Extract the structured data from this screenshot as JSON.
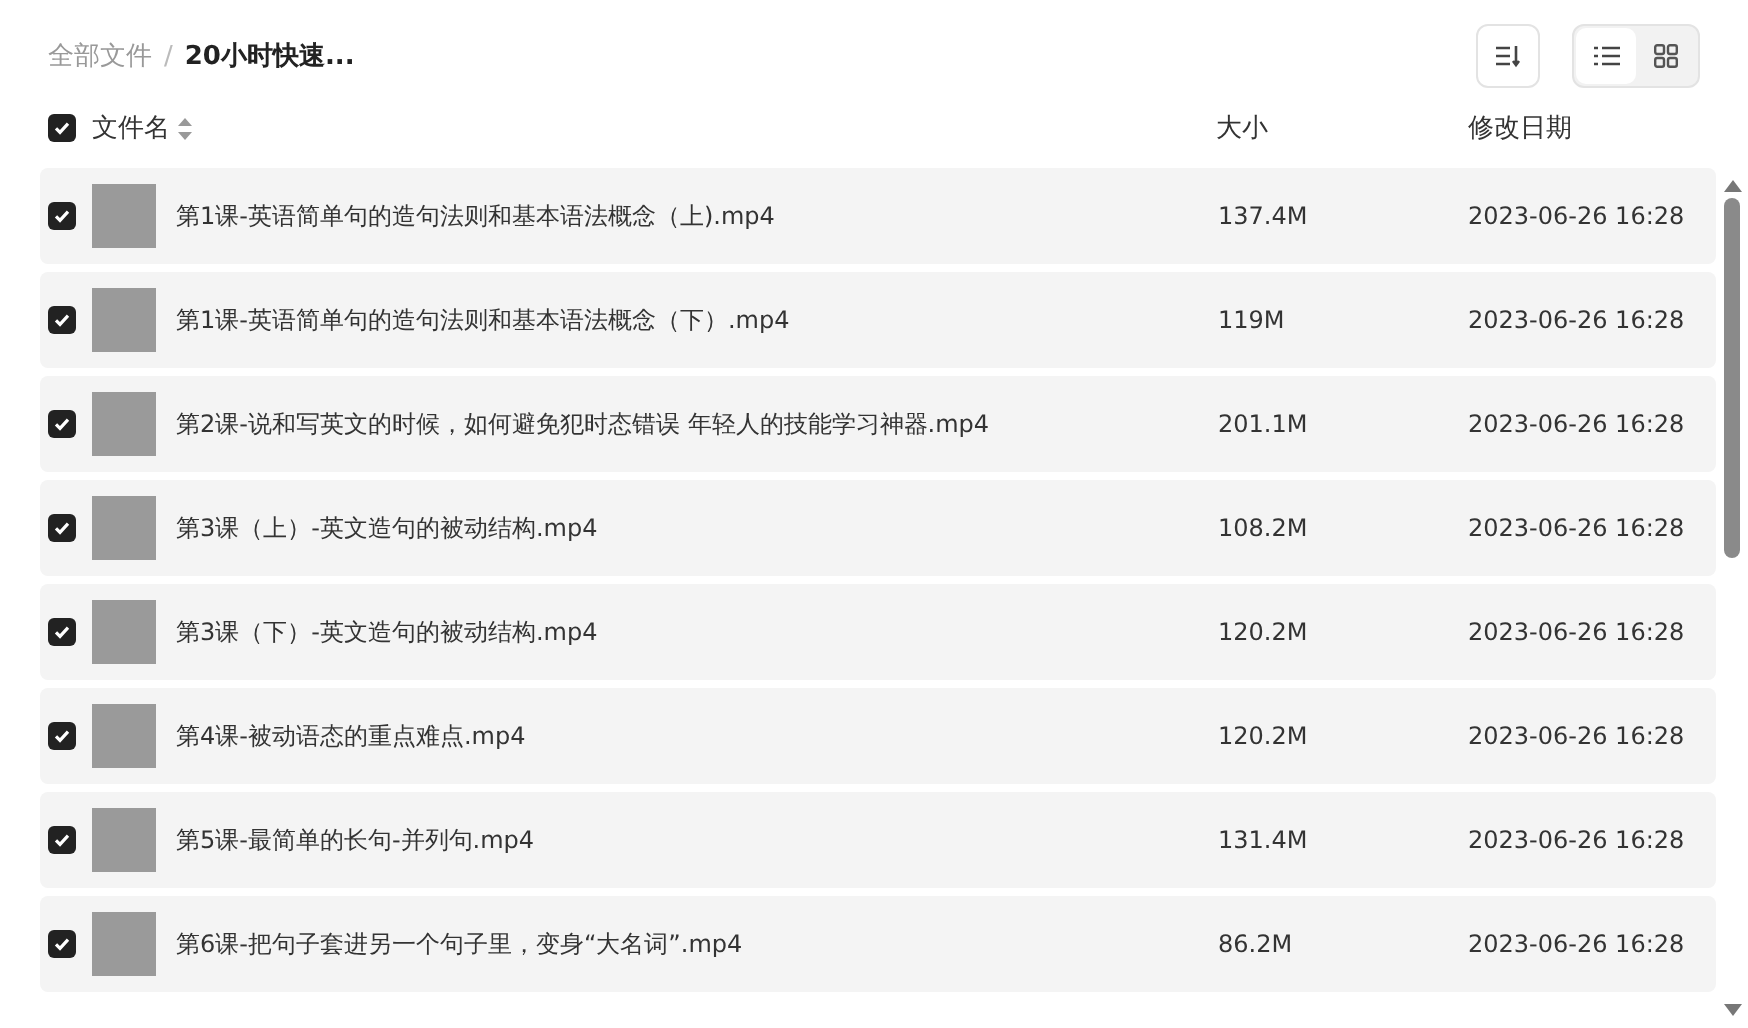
{
  "breadcrumb": [
    {
      "label": "全部文件",
      "current": false
    },
    {
      "label": "20小时快速...",
      "current": true
    }
  ],
  "breadcrumb_separator": "/",
  "view_toggle": [
    {
      "kind": "list",
      "selected": true
    },
    {
      "kind": "grid",
      "selected": false
    }
  ],
  "header": {
    "checked": true,
    "name": "文件名",
    "size": "大小",
    "date": "修改日期"
  },
  "rows": [
    {
      "checked": true,
      "name": "第1课-英语简单句的造句法则和基本语法概念（上).mp4",
      "size": "137.4M",
      "date": "2023-06-26 16:28"
    },
    {
      "checked": true,
      "name": "第1课-英语简单句的造句法则和基本语法概念（下）.mp4",
      "size": "119M",
      "date": "2023-06-26 16:28"
    },
    {
      "checked": true,
      "name": "第2课-说和写英文的时候，如何避免犯时态错误 年轻人的技能学习神器.mp4",
      "size": "201.1M",
      "date": "2023-06-26 16:28"
    },
    {
      "checked": true,
      "name": "第3课（上）-英文造句的被动结构.mp4",
      "size": "108.2M",
      "date": "2023-06-26 16:28"
    },
    {
      "checked": true,
      "name": "第3课（下）-英文造句的被动结构.mp4",
      "size": "120.2M",
      "date": "2023-06-26 16:28"
    },
    {
      "checked": true,
      "name": "第4课-被动语态的重点难点.mp4",
      "size": "120.2M",
      "date": "2023-06-26 16:28"
    },
    {
      "checked": true,
      "name": "第5课-最简单的长句-并列句.mp4",
      "size": "131.4M",
      "date": "2023-06-26 16:28"
    },
    {
      "checked": true,
      "name": "第6课-把句子套进另一个句子里，变身“大名词”.mp4",
      "size": "86.2M",
      "date": "2023-06-26 16:28"
    }
  ]
}
